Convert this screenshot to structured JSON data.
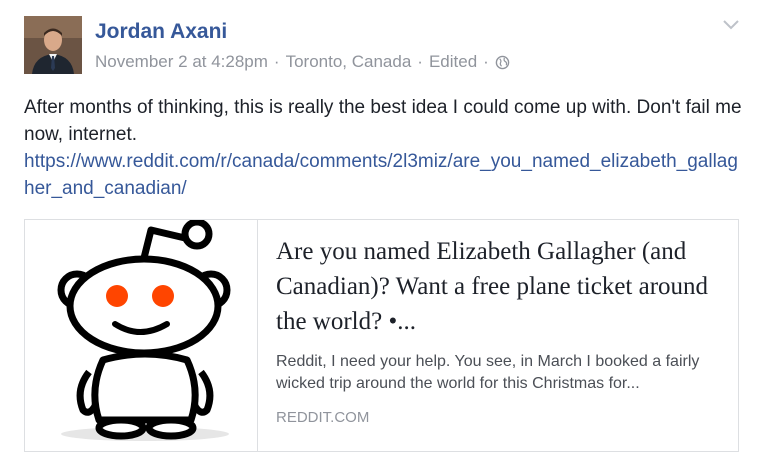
{
  "post": {
    "author": "Jordan Axani",
    "date": "November 2 at 4:28pm",
    "location": "Toronto, Canada",
    "edited": "Edited",
    "separator": "·",
    "text": "After months of thinking, this is really the best idea I could come up with. Don't fail me now, internet.",
    "link_url": "https://www.reddit.com/r/canada/comments/2l3miz/are_you_named_elizabeth_gallagher_and_canadian/",
    "audience_icon": "globe-icon",
    "menu_icon": "chevron-down-icon"
  },
  "link_preview": {
    "title": "Are you named Elizabeth Gallagher (and Canadian)? Want a free plane ticket around the world? •...",
    "description": "Reddit, I need your help. You see, in March I booked a fairly wicked trip around the world for this Christmas for...",
    "domain": "REDDIT.COM",
    "thumbnail_icon": "reddit-alien-icon"
  },
  "colors": {
    "link_blue": "#365899",
    "meta_gray": "#90949c",
    "reddit_eye_red": "#ff4500"
  }
}
